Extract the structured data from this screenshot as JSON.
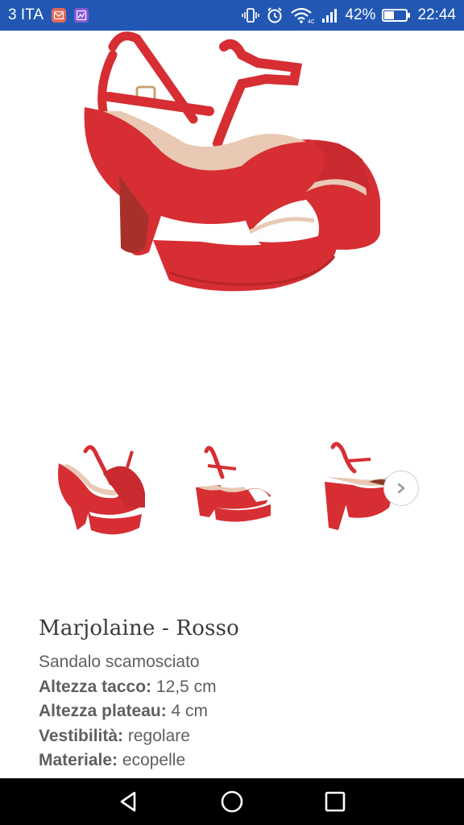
{
  "status_bar": {
    "carrier": "3 ITA",
    "battery_percent": "42%",
    "time": "22:44",
    "icons": [
      "mail-app-icon",
      "gallery-app-icon",
      "vibrate-icon",
      "alarm-icon",
      "wifi-icon",
      "signal-icon",
      "battery-icon"
    ]
  },
  "product": {
    "name": "Marjolaine - Rosso",
    "description": "Sandalo scamosciato",
    "specs": [
      {
        "label": "Altezza tacco:",
        "value": "12,5 cm"
      },
      {
        "label": "Altezza plateau:",
        "value": "4 cm"
      },
      {
        "label": "Vestibilità:",
        "value": "regolare"
      },
      {
        "label": "Materiale:",
        "value": "ecopelle"
      }
    ],
    "colors": {
      "shoe": "#d62e33",
      "shoe_dark": "#b8242a",
      "lining": "#e9c9b4"
    }
  },
  "gallery": {
    "next_icon": "chevron-right-icon"
  },
  "nav_bar": {
    "icons": [
      "back-icon",
      "home-icon",
      "recents-icon"
    ]
  }
}
